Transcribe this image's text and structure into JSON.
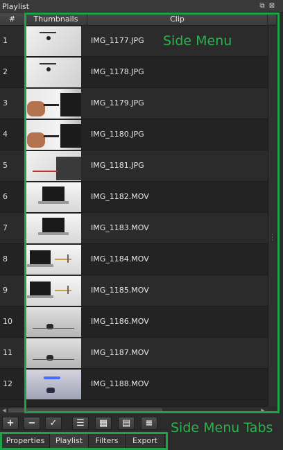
{
  "panel": {
    "title": "Playlist",
    "float_icon": "float-icon",
    "close_icon": "close-icon"
  },
  "table": {
    "headers": {
      "number": "#",
      "thumbnails": "Thumbnails",
      "clip": "Clip"
    },
    "rows": [
      {
        "num": "1",
        "clip": "IMG_1177.JPG",
        "thumb": "white"
      },
      {
        "num": "2",
        "clip": "IMG_1178.JPG",
        "thumb": "white"
      },
      {
        "num": "3",
        "clip": "IMG_1179.JPG",
        "thumb": "hand"
      },
      {
        "num": "4",
        "clip": "IMG_1180.JPG",
        "thumb": "hand"
      },
      {
        "num": "5",
        "clip": "IMG_1181.JPG",
        "thumb": "keyboard"
      },
      {
        "num": "6",
        "clip": "IMG_1182.MOV",
        "thumb": "laptop"
      },
      {
        "num": "7",
        "clip": "IMG_1183.MOV",
        "thumb": "laptop"
      },
      {
        "num": "8",
        "clip": "IMG_1184.MOV",
        "thumb": "laptop-cable"
      },
      {
        "num": "9",
        "clip": "IMG_1185.MOV",
        "thumb": "laptop-cable"
      },
      {
        "num": "10",
        "clip": "IMG_1186.MOV",
        "thumb": "device"
      },
      {
        "num": "11",
        "clip": "IMG_1187.MOV",
        "thumb": "device"
      },
      {
        "num": "12",
        "clip": "IMG_1188.MOV",
        "thumb": "blue-light"
      }
    ]
  },
  "toolbar": {
    "buttons": [
      {
        "name": "add-button",
        "glyph": "+"
      },
      {
        "name": "remove-button",
        "glyph": "−"
      },
      {
        "name": "check-button",
        "glyph": "✓"
      },
      {
        "name": "list-view-button",
        "glyph": "☰"
      },
      {
        "name": "grid-view-button",
        "glyph": "▦"
      },
      {
        "name": "table-view-button",
        "glyph": "▤"
      },
      {
        "name": "menu-button",
        "glyph": "≡"
      }
    ]
  },
  "tabs": [
    {
      "label": "Properties"
    },
    {
      "label": "Playlist"
    },
    {
      "label": "Filters"
    },
    {
      "label": "Export"
    }
  ],
  "annotations": {
    "side_menu": "Side Menu",
    "side_menu_tabs": "Side Menu Tabs",
    "color": "#1fa14a"
  }
}
